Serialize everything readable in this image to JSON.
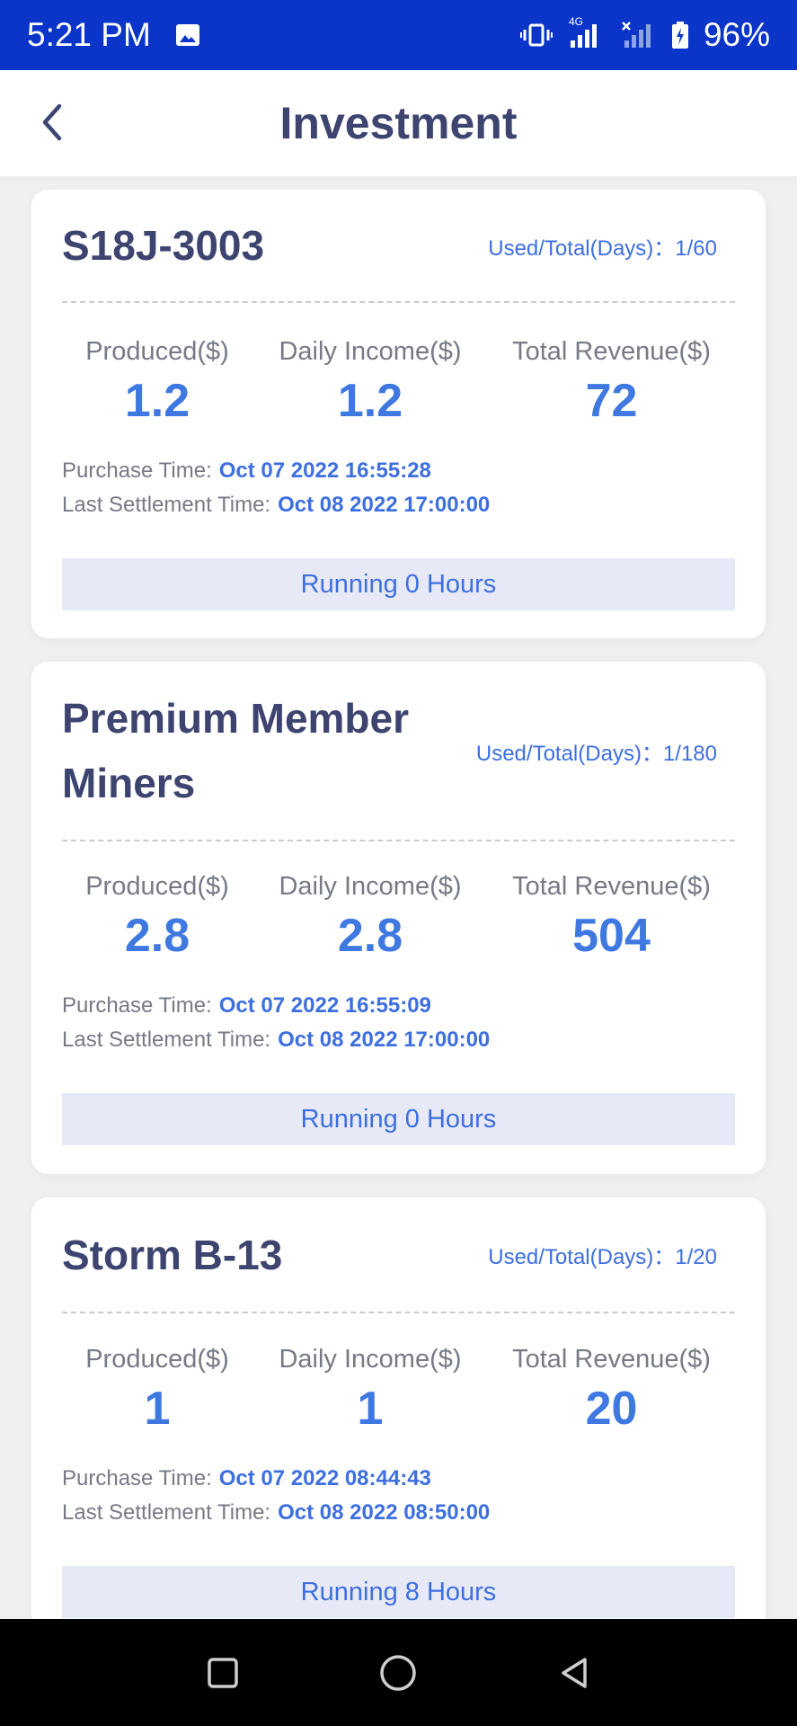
{
  "status_bar": {
    "time": "5:21 PM",
    "network_label": "4G",
    "battery": "96%",
    "icons": [
      "image-icon",
      "vibrate-icon",
      "signal-icon",
      "signal-x-icon",
      "battery-charging-icon"
    ]
  },
  "header": {
    "title": "Investment",
    "back_icon": "chevron-left-icon"
  },
  "cards": [
    {
      "name": "S18J-3003",
      "used_total": "Used/Total(Days)：1/60",
      "labels": {
        "produced": "Produced($)",
        "daily": "Daily Income($)",
        "total": "Total Revenue($)"
      },
      "produced": "1.2",
      "daily_income": "1.2",
      "total_revenue": "72",
      "purchase_label": "Purchase Time:",
      "purchase_time": "Oct 07 2022 16:55:28",
      "settlement_label": "Last Settlement Time:",
      "settlement_time": "Oct 08 2022 17:00:00",
      "running": "Running 0 Hours"
    },
    {
      "name": "Premium Member Miners",
      "used_total": "Used/Total(Days)：1/180",
      "labels": {
        "produced": "Produced($)",
        "daily": "Daily Income($)",
        "total": "Total Revenue($)"
      },
      "produced": "2.8",
      "daily_income": "2.8",
      "total_revenue": "504",
      "purchase_label": "Purchase Time:",
      "purchase_time": "Oct 07 2022 16:55:09",
      "settlement_label": "Last Settlement Time:",
      "settlement_time": "Oct 08 2022 17:00:00",
      "running": "Running 0 Hours"
    },
    {
      "name": "Storm B-13",
      "used_total": "Used/Total(Days)：1/20",
      "labels": {
        "produced": "Produced($)",
        "daily": "Daily Income($)",
        "total": "Total Revenue($)"
      },
      "produced": "1",
      "daily_income": "1",
      "total_revenue": "20",
      "purchase_label": "Purchase Time:",
      "purchase_time": "Oct 07 2022 08:44:43",
      "settlement_label": "Last Settlement Time:",
      "settlement_time": "Oct 08 2022 08:50:00",
      "running": "Running 8 Hours"
    }
  ],
  "nav_bar": {
    "icons": [
      "recents-square-icon",
      "home-circle-icon",
      "back-triangle-icon"
    ]
  },
  "colors": {
    "status_bar": "#0a35c8",
    "title": "#3e4470",
    "accent": "#3e78e0",
    "running_bg": "#e8e9f6",
    "page_bg": "#efeff2"
  }
}
